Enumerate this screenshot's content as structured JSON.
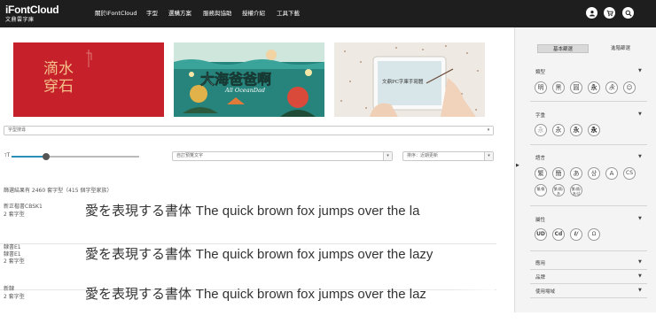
{
  "header": {
    "logo": "iFontCloud",
    "logo_sub": "文鼎雲字庫",
    "nav": [
      "關於iFontCloud",
      "字型",
      "選購方案",
      "服務與協助",
      "授權介紹",
      "工具下載"
    ],
    "icons": [
      "user-icon",
      "cart-icon",
      "search-icon"
    ]
  },
  "banners": [
    {
      "name": "banner-red",
      "text": "滴水穿石",
      "color": "#c6202a"
    },
    {
      "name": "banner-ocean",
      "title": "大海爸爸啊",
      "subtitle": "All OceanDad",
      "color": "#1f7a74"
    },
    {
      "name": "banner-tablet",
      "text": "文鼎PC字庫手寫體",
      "color": "#ece6de"
    }
  ],
  "filters": {
    "category_placeholder": "字型搜尋",
    "size_label": "T",
    "sample_placeholder": "自訂預覽文字",
    "sort_label": "排序：近期更新",
    "size_value": 0.27
  },
  "results": {
    "summary": "篩選結果有 2460 套字型（415 個字型家族）"
  },
  "fonts": [
    {
      "name": "新正楷書CBSK1",
      "count": "2 套字型",
      "sample_jp": "愛を表現する書体",
      "sample_en": "The quick brown fox jumps over the la"
    },
    {
      "name": "隸書E1",
      "name2": "隸書E1",
      "count": "2 套字型",
      "sample_jp": "愛を表現する書体",
      "sample_en": "The quick brown fox jumps over the lazy"
    },
    {
      "name": "新隸",
      "count": "2 套字型",
      "sample_jp": "愛を表現する書体",
      "sample_en": "The quick brown fox jumps over the laz"
    }
  ],
  "panel": {
    "tab_basic": "基本篩選",
    "tab_advanced": "進階篩選",
    "sections": {
      "style": {
        "title": "類型",
        "items": [
          "明",
          "黑",
          "圓",
          "永",
          "永",
          "☺"
        ]
      },
      "weight": {
        "title": "字重",
        "items": [
          "永",
          "永",
          "永",
          "永"
        ]
      },
      "language": {
        "title": "語言",
        "items": [
          "繁",
          "簡",
          "あ",
          "상",
          "A",
          "CS"
        ],
        "items_small": [
          "繁/簡",
          "繁/簡/あ",
          "繁/簡/あ/상"
        ]
      },
      "feature": {
        "title": "屬性",
        "items": [
          "UD",
          "Cd",
          "I/",
          "Ω"
        ]
      },
      "use": {
        "title": "應用"
      },
      "brand": {
        "title": "品牌"
      },
      "scenario": {
        "title": "使用場域"
      }
    }
  },
  "colors": {
    "topbar": "#1e1e1e",
    "accent": "#2a8fb8",
    "panel_bg": "#f4f4f4"
  }
}
